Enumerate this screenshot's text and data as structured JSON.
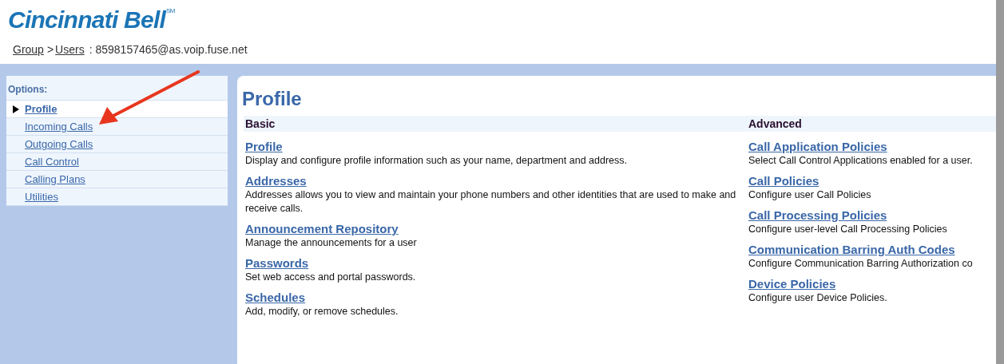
{
  "logo": {
    "name": "Cincinnati Bell",
    "mark": "SM"
  },
  "breadcrumb": {
    "links": [
      "Group",
      "Users"
    ],
    "separator": ">",
    "trail": ": 8598157465@as.voip.fuse.net"
  },
  "sidebar": {
    "heading": "Options:",
    "items": [
      {
        "label": "Profile",
        "selected": true
      },
      {
        "label": "Incoming Calls",
        "selected": false
      },
      {
        "label": "Outgoing Calls",
        "selected": false
      },
      {
        "label": "Call Control",
        "selected": false
      },
      {
        "label": "Calling Plans",
        "selected": false
      },
      {
        "label": "Utilities",
        "selected": false
      }
    ]
  },
  "page_title": "Profile",
  "sections": [
    {
      "heading": "Basic",
      "entries": [
        {
          "link": "Profile",
          "description": "Display and configure profile information such as your name, department and address."
        },
        {
          "link": "Addresses",
          "description": "Addresses allows you to view and maintain your phone numbers and other identities that are used to make and receive calls."
        },
        {
          "link": "Announcement Repository",
          "description": "Manage the announcements for a user"
        },
        {
          "link": "Passwords",
          "description": "Set web access and portal passwords."
        },
        {
          "link": "Schedules",
          "description": "Add, modify, or remove schedules."
        }
      ]
    },
    {
      "heading": "Advanced",
      "entries": [
        {
          "link": "Call Application Policies",
          "description": "Select Call Control Applications enabled for a user."
        },
        {
          "link": "Call Policies",
          "description": "Configure user Call Policies"
        },
        {
          "link": "Call Processing Policies",
          "description": "Configure user-level Call Processing Policies"
        },
        {
          "link": "Communication Barring Auth Codes",
          "description": "Configure Communication Barring Authorization co"
        },
        {
          "link": "Device Policies",
          "description": "Configure user Device Policies."
        }
      ]
    }
  ]
}
